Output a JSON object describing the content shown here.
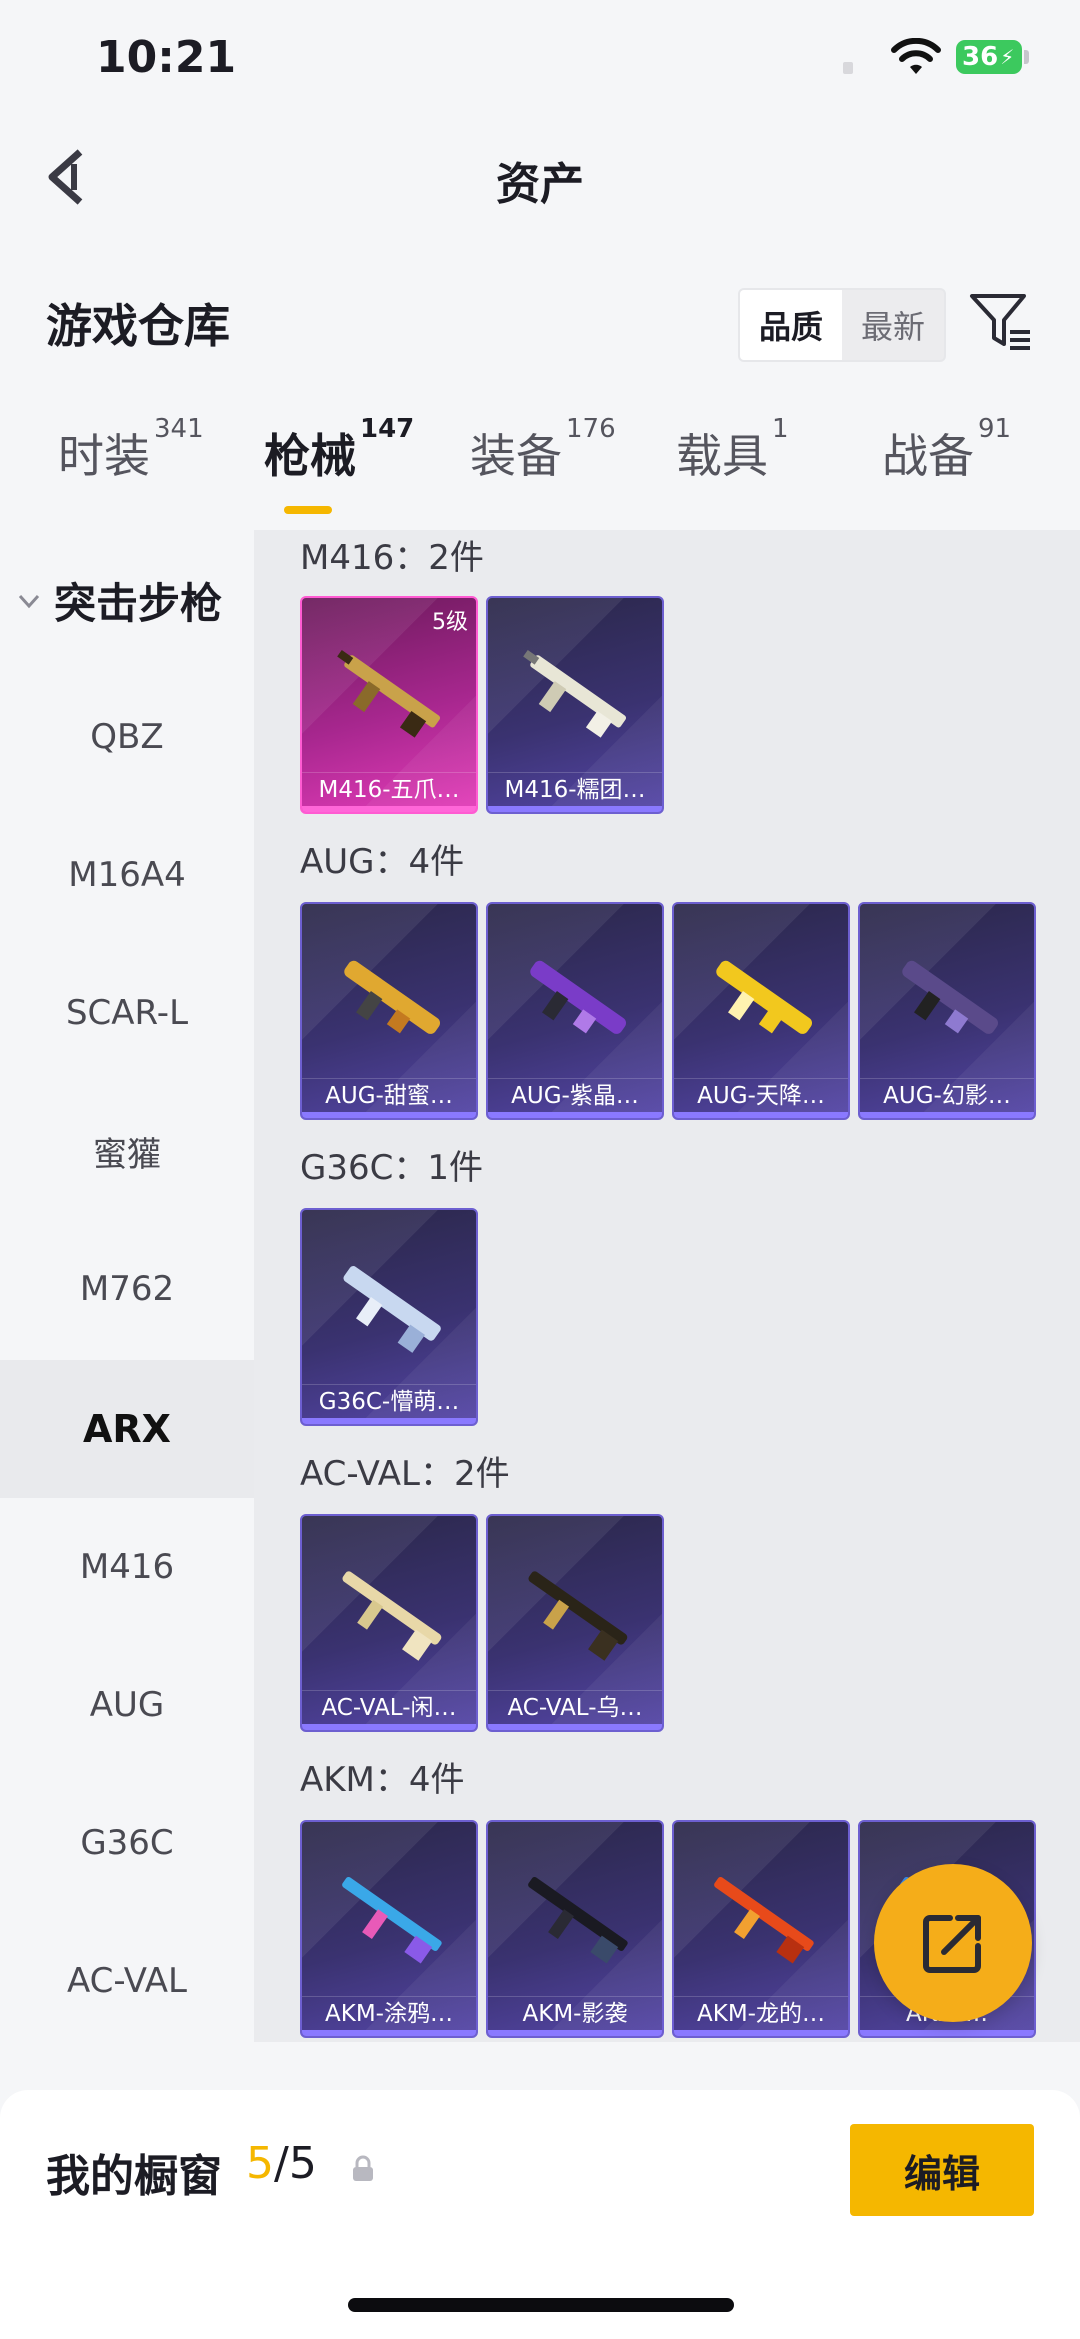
{
  "status_bar": {
    "time": "10:21",
    "battery": "36"
  },
  "header": {
    "title": "资产"
  },
  "warehouse": {
    "title": "游戏仓库",
    "sort_options": [
      "品质",
      "最新"
    ]
  },
  "tabs": [
    {
      "label": "时装",
      "count": "341"
    },
    {
      "label": "枪械",
      "count": "147"
    },
    {
      "label": "装备",
      "count": "176"
    },
    {
      "label": "载具",
      "count": "1"
    },
    {
      "label": "战备",
      "count": "91"
    }
  ],
  "sidebar": {
    "group": "突击步枪",
    "items": [
      "QBZ",
      "M16A4",
      "SCAR-L",
      "蜜獾",
      "M762",
      "ARX",
      "M416",
      "AUG",
      "G36C",
      "AC-VAL"
    ]
  },
  "groups": [
    {
      "label": "M416：2件",
      "items": [
        {
          "name": "M416-五爪…",
          "level": "5级"
        },
        {
          "name": "M416-糯团…"
        }
      ]
    },
    {
      "label": "AUG：4件",
      "items": [
        {
          "name": "AUG-甜蜜…"
        },
        {
          "name": "AUG-紫晶…"
        },
        {
          "name": "AUG-天降…"
        },
        {
          "name": "AUG-幻影…"
        }
      ]
    },
    {
      "label": "G36C：1件",
      "items": [
        {
          "name": "G36C-懵萌…"
        }
      ]
    },
    {
      "label": "AC-VAL：2件",
      "items": [
        {
          "name": "AC-VAL-闲…"
        },
        {
          "name": "AC-VAL-乌…"
        }
      ]
    },
    {
      "label": "AKM：4件",
      "items": [
        {
          "name": "AKM-涂鸦…"
        },
        {
          "name": "AKM-影袭"
        },
        {
          "name": "AKM-龙的…"
        },
        {
          "name": "AKM-…"
        }
      ]
    }
  ],
  "showcase": {
    "label": "我的橱窗",
    "current": "5",
    "total": "/5",
    "edit_label": "编辑"
  },
  "colors": {
    "accent": "#f5b700",
    "card_epic": "#5546a8",
    "card_legend": "#e43cb9"
  },
  "icons": [
    "back-arrow-icon",
    "filter-icon",
    "chevron-down-icon",
    "lock-icon",
    "share-icon",
    "wifi-icon"
  ]
}
